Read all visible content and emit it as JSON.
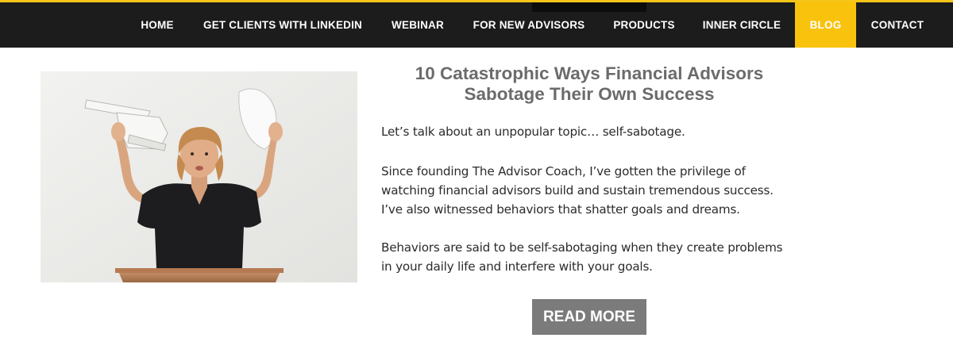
{
  "brand": {
    "accent_color": "#f9c20c",
    "nav_bg": "#1c1c1c"
  },
  "nav": {
    "items": [
      {
        "label": "HOME"
      },
      {
        "label": "GET CLIENTS WITH LINKEDIN"
      },
      {
        "label": "WEBINAR"
      },
      {
        "label": "FOR NEW ADVISORS"
      },
      {
        "label": "PRODUCTS"
      },
      {
        "label": "INNER CIRCLE"
      },
      {
        "label": "BLOG",
        "active": true
      },
      {
        "label": "CONTACT"
      }
    ]
  },
  "post": {
    "title_line1": "10 Catastrophic Ways Financial Advisors",
    "title_line2": "Sabotage Their Own Success",
    "image_icon": "woman-throwing-papers-photo",
    "excerpt": {
      "p1": "Let’s talk about an unpopular topic… self-sabotage.",
      "p2_l1": "Since founding The Advisor Coach, I’ve gotten the privilege of",
      "p2_l2": "watching financial advisors build and sustain tremendous success.",
      "p2_l3": "I’ve also witnessed behaviors that shatter goals and dreams.",
      "p3_l1": "Behaviors are said to be self-sabotaging when they create problems",
      "p3_l2": "in your daily life and interfere with your goals."
    },
    "read_more_label": "READ MORE"
  }
}
